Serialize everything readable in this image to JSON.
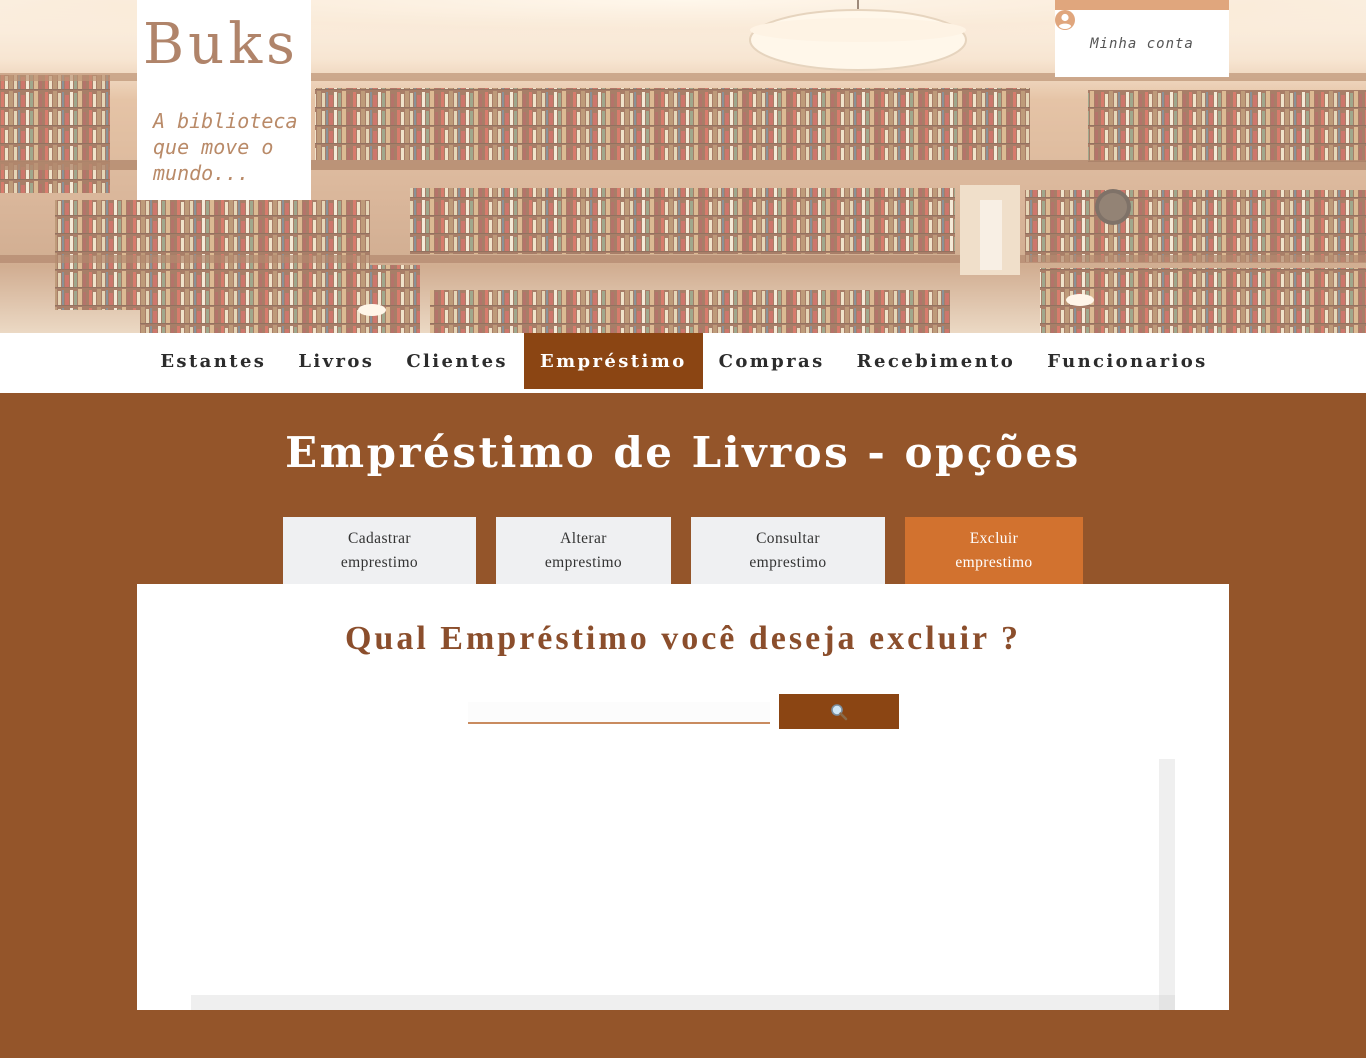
{
  "brand": {
    "title": "Buks",
    "tagline": "A biblioteca que move o mundo..."
  },
  "account": {
    "label": "Minha conta",
    "icon": "user-circle-icon"
  },
  "nav": {
    "items": [
      {
        "label": "Estantes",
        "active": false
      },
      {
        "label": "Livros",
        "active": false
      },
      {
        "label": "Clientes",
        "active": false
      },
      {
        "label": "Empréstimo",
        "active": true
      },
      {
        "label": "Compras",
        "active": false
      },
      {
        "label": "Recebimento",
        "active": false
      },
      {
        "label": "Funcionarios",
        "active": false
      }
    ]
  },
  "page": {
    "title": "Empréstimo de Livros - opções"
  },
  "tabs": [
    {
      "line1": "Cadastrar",
      "line2": "emprestimo",
      "active": false
    },
    {
      "line1": "Alterar",
      "line2": "emprestimo",
      "active": false
    },
    {
      "line1": "Consultar",
      "line2": "emprestimo",
      "active": false
    },
    {
      "line1": "Excluir",
      "line2": "emprestimo",
      "active": true
    }
  ],
  "panel": {
    "question": "Qual Empréstimo você deseja excluir ?",
    "search": {
      "value": "",
      "placeholder": "",
      "button_icon": "search-icon"
    }
  },
  "colors": {
    "page_background": "#94552a",
    "nav_active": "#8b4513",
    "tab_active": "#d2722f",
    "tab_inactive": "#eff0f2",
    "question_text": "#8b4e2c",
    "brand_text": "#b0846a",
    "account_accent": "#e0a67d"
  }
}
